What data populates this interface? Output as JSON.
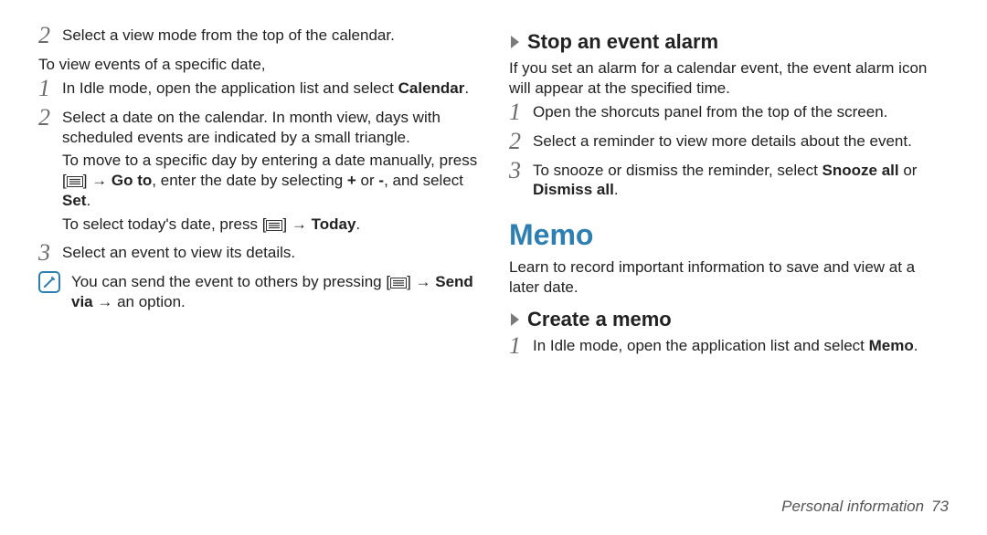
{
  "left": {
    "step2_top": "Select a view mode from the top of the calendar.",
    "view_specific_date": "To view events of a specific date,",
    "s1_prefix": "In Idle mode, open the application list and select ",
    "s1_bold": "Calendar",
    "s1_suffix": ".",
    "s2": "Select a date on the calendar. In month view, days with scheduled events are indicated by a small triangle.",
    "s2a_prefix": "To move to a specific day by entering a date manually, press [",
    "s2a_mid1": "] → ",
    "s2a_bold_goto": "Go to",
    "s2a_mid2": ", enter the date by selecting ",
    "s2a_bold_plus": "+",
    "s2a_mid3": " or ",
    "s2a_bold_minus": "-",
    "s2a_mid4": ", and select ",
    "s2a_bold_set": "Set",
    "s2a_suffix": ".",
    "s2b_prefix": "To select today's date, press [",
    "s2b_mid": "] → ",
    "s2b_bold_today": "Today",
    "s2b_suffix": ".",
    "s3": "Select an event to view its details.",
    "note_prefix": "You can send the event to others by pressing [",
    "note_mid1": "] → ",
    "note_bold_sendvia": "Send via",
    "note_suffix": " → an option."
  },
  "right": {
    "h_stop": "Stop an event alarm",
    "stop_intro": "If you set an alarm for a calendar event, the event alarm icon will appear at the specified time.",
    "stop1": "Open the shorcuts panel from the top of the screen.",
    "stop2": "Select a reminder to view more details about the event.",
    "stop3_prefix": "To snooze or dismiss the reminder, select ",
    "stop3_bold_snooze": "Snooze all",
    "stop3_mid": " or ",
    "stop3_bold_dismiss": "Dismiss all",
    "stop3_suffix": ".",
    "h_memo": "Memo",
    "memo_intro": "Learn to record important information to save and view at a later date.",
    "h_create": "Create a memo",
    "create1_prefix": "In Idle mode, open the application list and select ",
    "create1_bold": "Memo",
    "create1_suffix": "."
  },
  "footer": {
    "section": "Personal information",
    "page": "73"
  },
  "nums": {
    "n1": "1",
    "n2": "2",
    "n3": "3"
  }
}
